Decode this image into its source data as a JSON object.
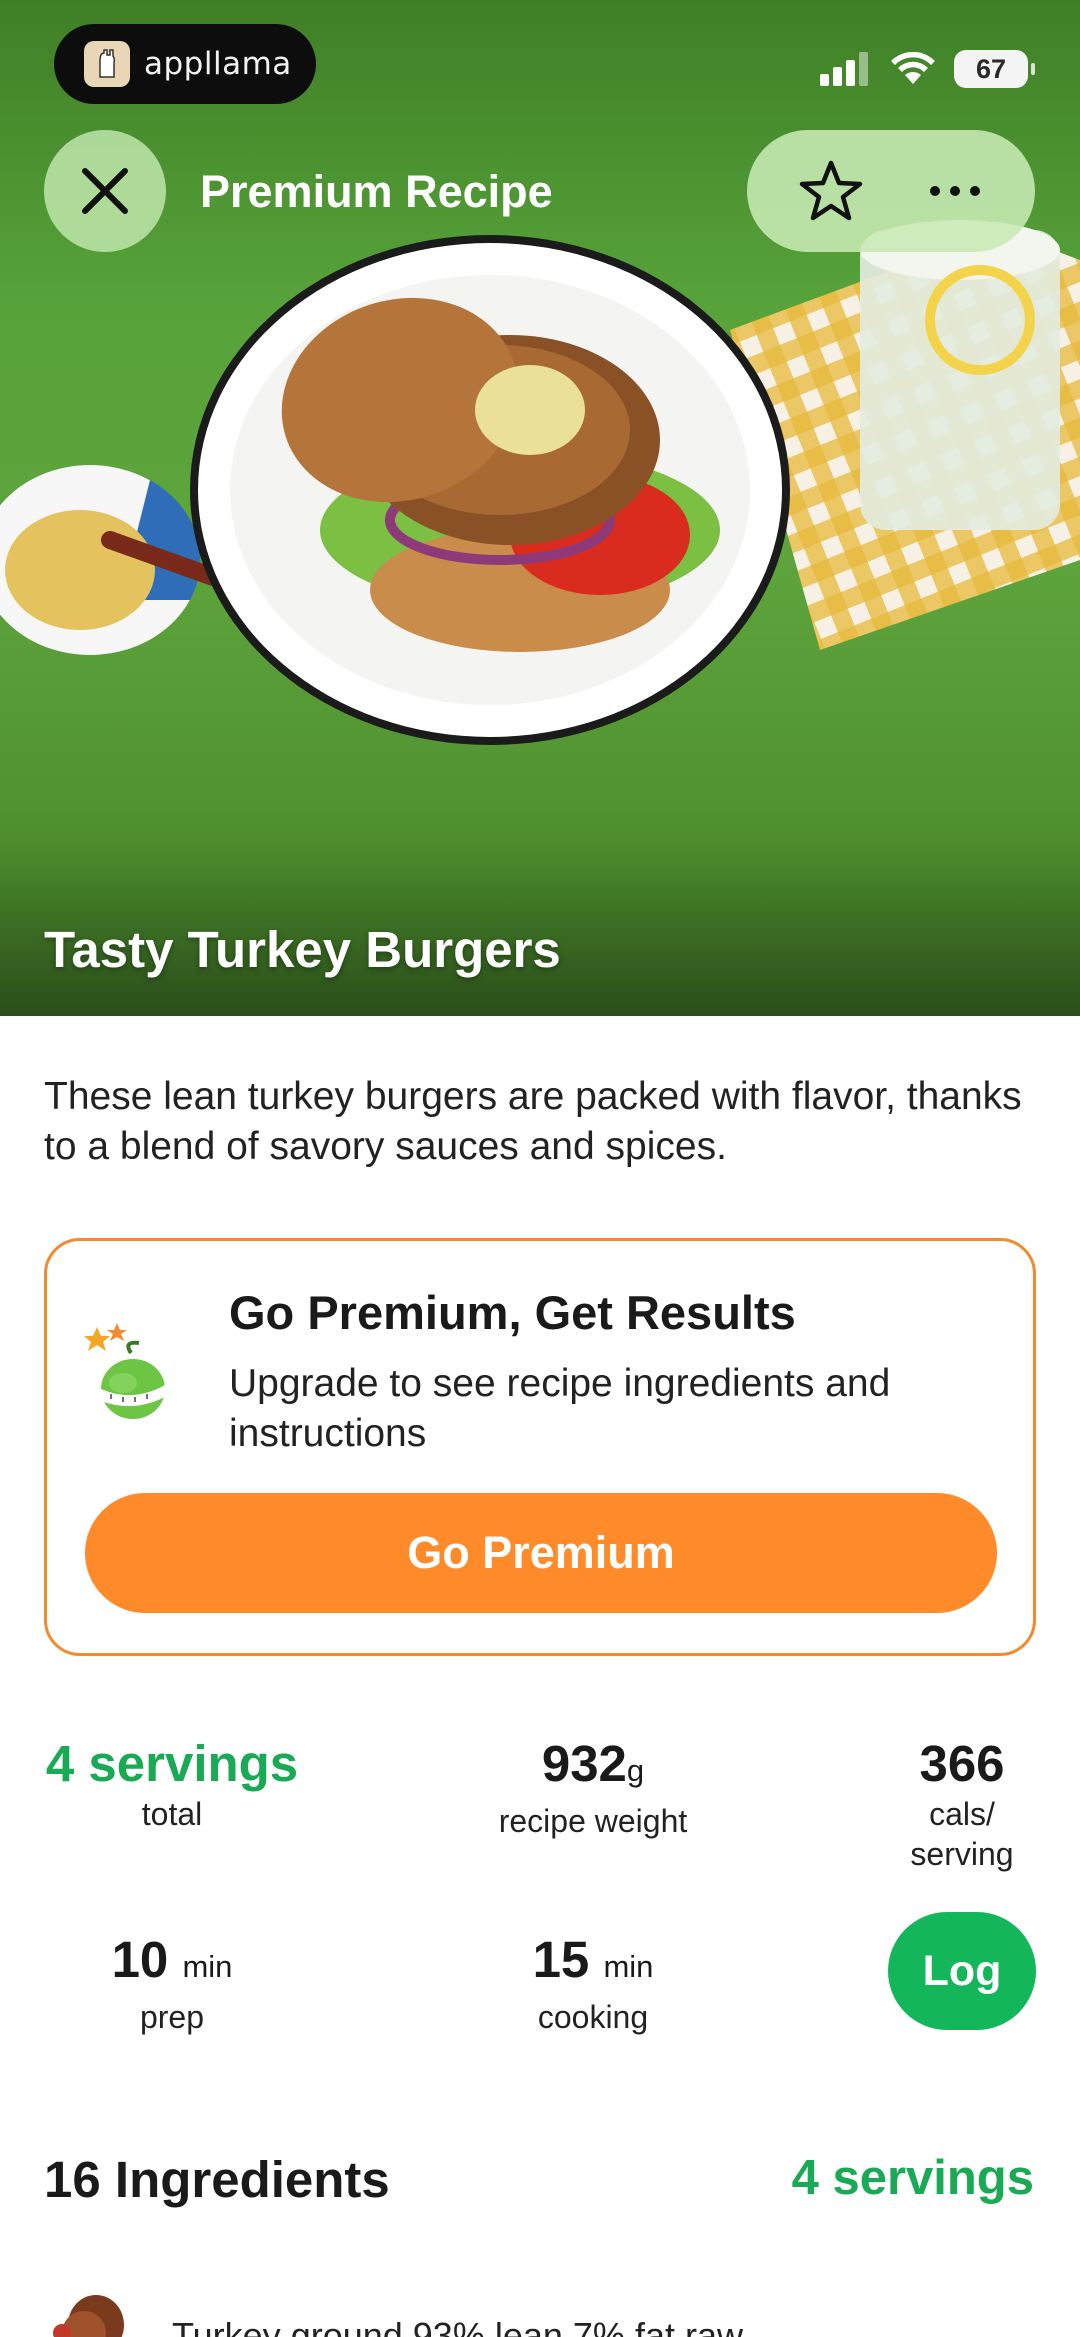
{
  "status_bar": {
    "app_name": "appllama",
    "battery": "67"
  },
  "header": {
    "title": "Premium Recipe"
  },
  "recipe": {
    "name": "Tasty Turkey Burgers",
    "description": "These lean turkey burgers are packed with flavor, thanks to a blend of savory sauces and spices."
  },
  "promo": {
    "title": "Go Premium, Get Results",
    "subtitle": "Upgrade to see recipe ingredients and instructions",
    "button_label": "Go Premium"
  },
  "stats": {
    "servings_value": "4 servings",
    "servings_label": "total",
    "weight_value": "932",
    "weight_unit": "g",
    "weight_label": "recipe weight",
    "cals_value": "366",
    "cals_label_1": "cals/",
    "cals_label_2": "serving",
    "prep_value": "10",
    "prep_unit": "min",
    "prep_label": "prep",
    "cook_value": "15",
    "cook_unit": "min",
    "cook_label": "cooking",
    "log_label": "Log"
  },
  "ingredients": {
    "title": "16 Ingredients",
    "servings": "4 servings",
    "first_item": "Turkey ground 93% lean 7% fat raw"
  },
  "colors": {
    "accent_green": "#1aaa55",
    "premium_orange": "#ff8a2a"
  }
}
